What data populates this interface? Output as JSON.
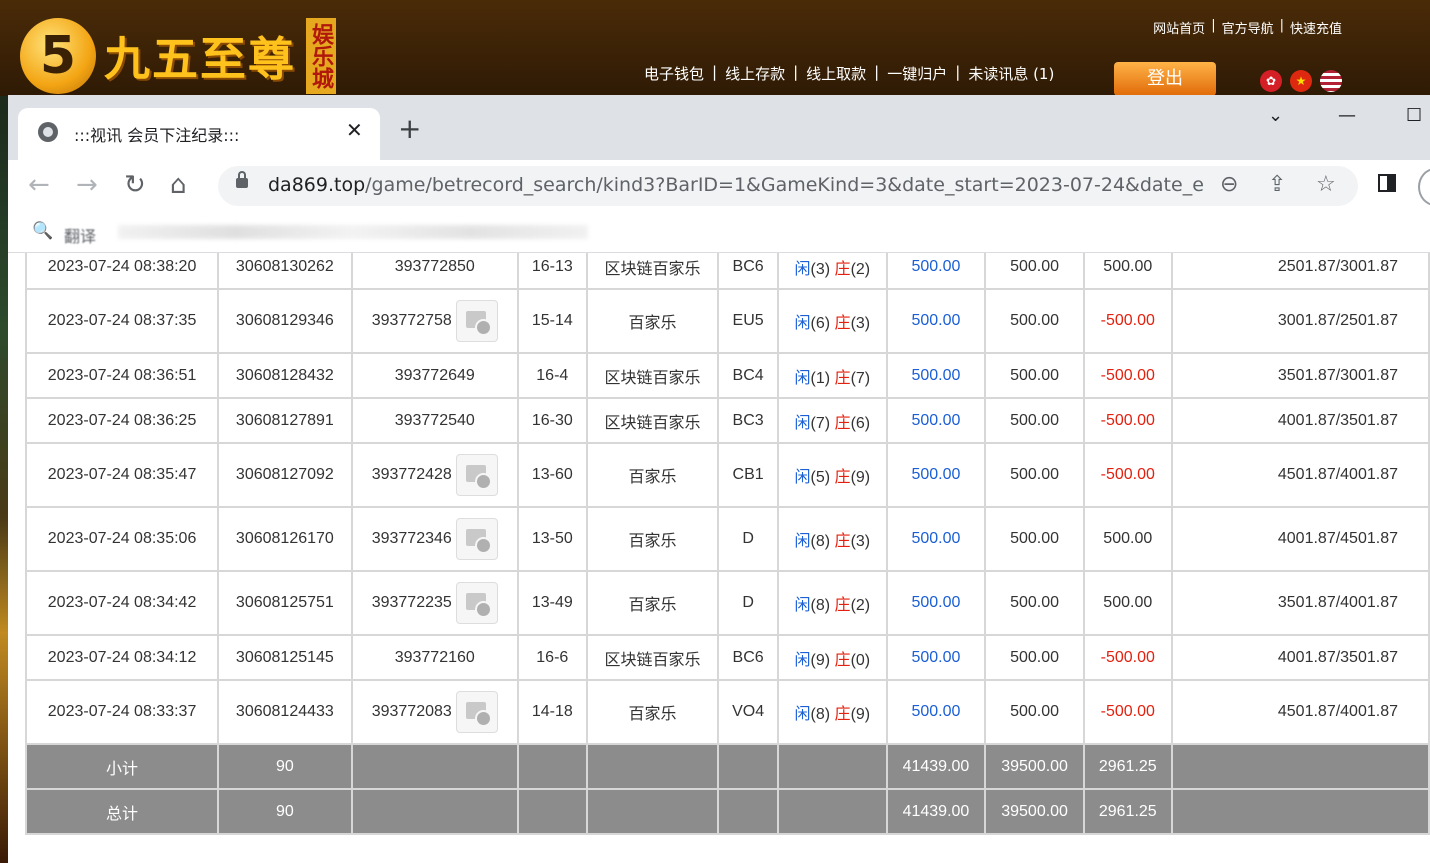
{
  "site": {
    "logo_number": "5",
    "logo_text": "九五至尊",
    "logo_vertical": "娱乐城",
    "top_links": [
      "网站首页",
      "官方导航",
      "快速充值"
    ],
    "nav_links": [
      "电子钱包",
      "线上存款",
      "线上取款",
      "一键归户",
      "未读讯息 (1)"
    ],
    "logout_label": "登出",
    "flags": [
      "hk-flag-icon",
      "cn-flag-icon",
      "us-flag-icon"
    ]
  },
  "browser": {
    "tab_title": ":::视讯 会员下注纪录:::",
    "tab_close": "✕",
    "new_tab": "+",
    "url_host": "da869.top",
    "url_path": "/game/betrecord_search/kind3?BarID=1&GameKind=3&date_start=2023-07-24&date_e...",
    "bookmark_label": "翻译"
  },
  "table": {
    "rows": [
      {
        "time": "2023-07-24 08:38:20",
        "bet_id": "30608130262",
        "round": "393772850",
        "video": false,
        "table_no": "16-13",
        "game": "区块链百家乐",
        "room": "BC6",
        "player": "3",
        "banker": "2",
        "bet": "500.00",
        "valid": "500.00",
        "win": "500.00",
        "win_neg": false,
        "balance": "2501.87/3001.87",
        "tall": false
      },
      {
        "time": "2023-07-24 08:37:35",
        "bet_id": "30608129346",
        "round": "393772758",
        "video": true,
        "table_no": "15-14",
        "game": "百家乐",
        "room": "EU5",
        "player": "6",
        "banker": "3",
        "bet": "500.00",
        "valid": "500.00",
        "win": "-500.00",
        "win_neg": true,
        "balance": "3001.87/2501.87",
        "tall": true
      },
      {
        "time": "2023-07-24 08:36:51",
        "bet_id": "30608128432",
        "round": "393772649",
        "video": false,
        "table_no": "16-4",
        "game": "区块链百家乐",
        "room": "BC4",
        "player": "1",
        "banker": "7",
        "bet": "500.00",
        "valid": "500.00",
        "win": "-500.00",
        "win_neg": true,
        "balance": "3501.87/3001.87",
        "tall": false
      },
      {
        "time": "2023-07-24 08:36:25",
        "bet_id": "30608127891",
        "round": "393772540",
        "video": false,
        "table_no": "16-30",
        "game": "区块链百家乐",
        "room": "BC3",
        "player": "7",
        "banker": "6",
        "bet": "500.00",
        "valid": "500.00",
        "win": "-500.00",
        "win_neg": true,
        "balance": "4001.87/3501.87",
        "tall": false
      },
      {
        "time": "2023-07-24 08:35:47",
        "bet_id": "30608127092",
        "round": "393772428",
        "video": true,
        "table_no": "13-60",
        "game": "百家乐",
        "room": "CB1",
        "player": "5",
        "banker": "9",
        "bet": "500.00",
        "valid": "500.00",
        "win": "-500.00",
        "win_neg": true,
        "balance": "4501.87/4001.87",
        "tall": true
      },
      {
        "time": "2023-07-24 08:35:06",
        "bet_id": "30608126170",
        "round": "393772346",
        "video": true,
        "table_no": "13-50",
        "game": "百家乐",
        "room": "D",
        "player": "8",
        "banker": "3",
        "bet": "500.00",
        "valid": "500.00",
        "win": "500.00",
        "win_neg": false,
        "balance": "4001.87/4501.87",
        "tall": true
      },
      {
        "time": "2023-07-24 08:34:42",
        "bet_id": "30608125751",
        "round": "393772235",
        "video": true,
        "table_no": "13-49",
        "game": "百家乐",
        "room": "D",
        "player": "8",
        "banker": "2",
        "bet": "500.00",
        "valid": "500.00",
        "win": "500.00",
        "win_neg": false,
        "balance": "3501.87/4001.87",
        "tall": true
      },
      {
        "time": "2023-07-24 08:34:12",
        "bet_id": "30608125145",
        "round": "393772160",
        "video": false,
        "table_no": "16-6",
        "game": "区块链百家乐",
        "room": "BC6",
        "player": "9",
        "banker": "0",
        "bet": "500.00",
        "valid": "500.00",
        "win": "-500.00",
        "win_neg": true,
        "balance": "4001.87/3501.87",
        "tall": false
      },
      {
        "time": "2023-07-24 08:33:37",
        "bet_id": "30608124433",
        "round": "393772083",
        "video": true,
        "table_no": "14-18",
        "game": "百家乐",
        "room": "VO4",
        "player": "8",
        "banker": "9",
        "bet": "500.00",
        "valid": "500.00",
        "win": "-500.00",
        "win_neg": true,
        "balance": "4501.87/4001.87",
        "tall": true
      }
    ],
    "player_label": "闲",
    "banker_label": "庄",
    "subtotal": {
      "label": "小计",
      "count": "90",
      "bet": "41439.00",
      "valid": "39500.00",
      "win": "2961.25"
    },
    "total": {
      "label": "总计",
      "count": "90",
      "bet": "41439.00",
      "valid": "39500.00",
      "win": "2961.25"
    }
  },
  "colors": {
    "positive": "#1a5fd6",
    "negative": "#e4200e",
    "summary_bg": "#8c8c8c"
  }
}
